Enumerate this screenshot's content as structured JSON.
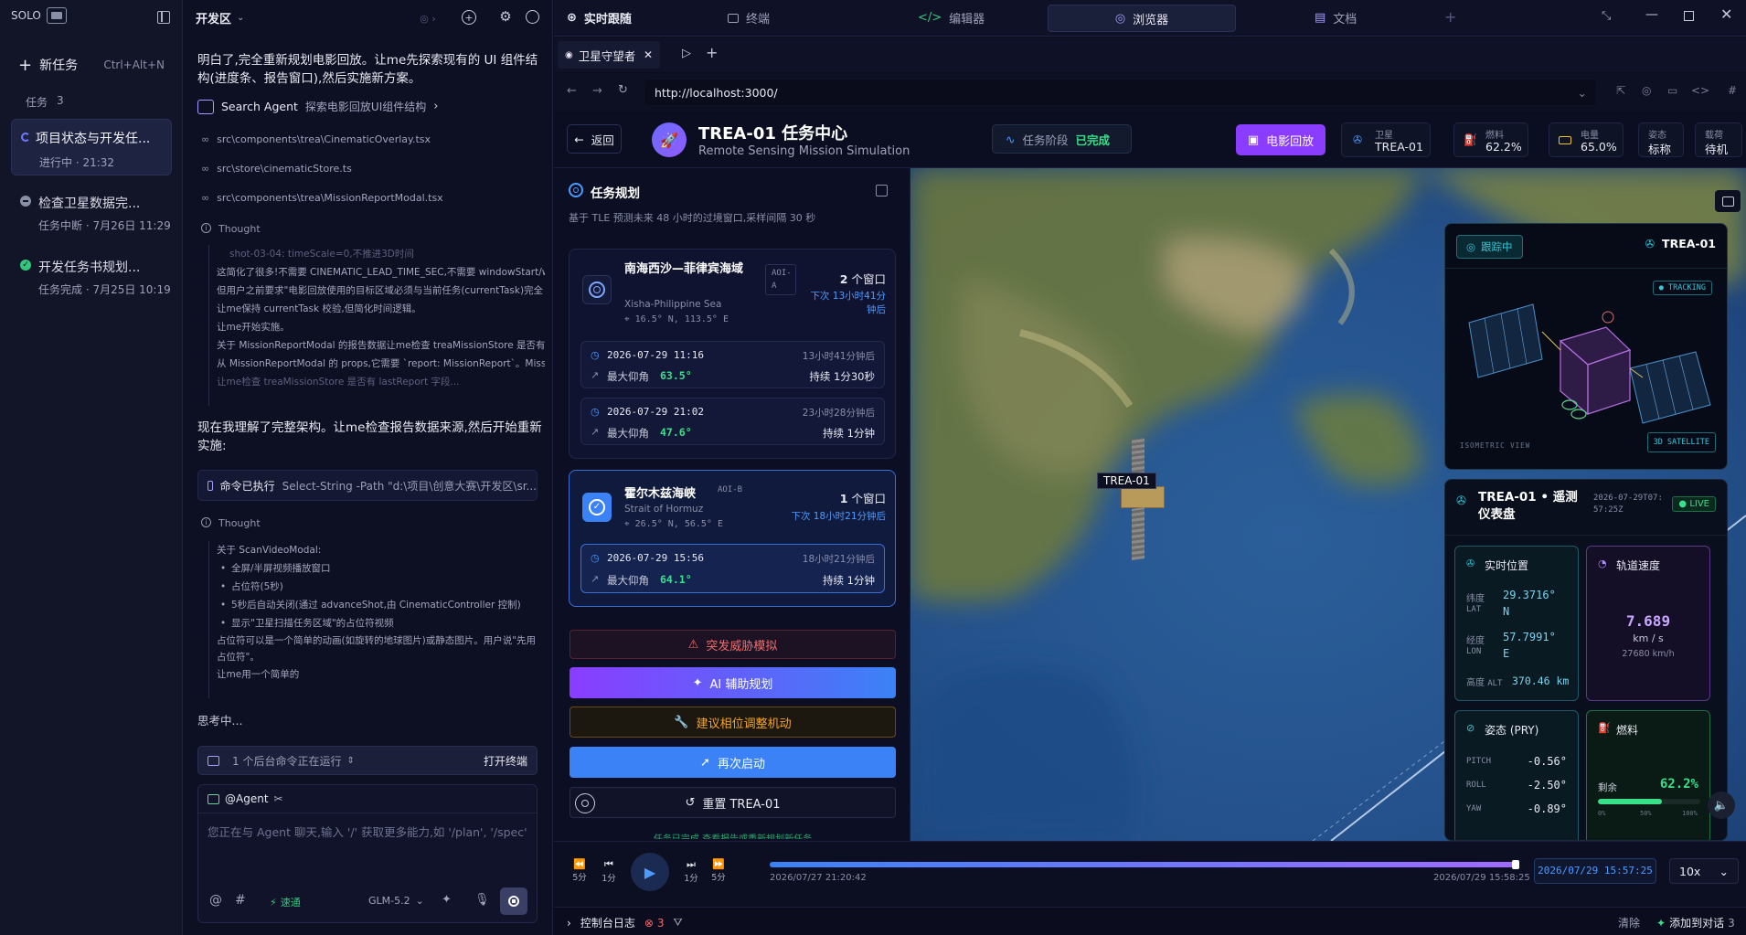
{
  "sidebar": {
    "brand": "SOLO",
    "new_task": "新任务",
    "new_task_shortcut": "Ctrl+Alt+N",
    "tasks_label": "任务",
    "tasks_count": "3",
    "tasks": [
      {
        "title": "项目状态与开发任...",
        "status": "进行中 · 21:32"
      },
      {
        "title": "检查卫星数据完...",
        "status": "任务中断 · 7月26日 11:29"
      },
      {
        "title": "开发任务书规划...",
        "status": "任务完成 · 7月25日 10:19"
      }
    ]
  },
  "chat": {
    "workspace": "开发区",
    "intro": "明白了,完全重新规划电影回放。让me先探索现有的 UI 组件结构(进度条、报告窗口),然后实施新方案。",
    "agent_name": "Search Agent",
    "agent_action": "探索电影回放UI组件结构",
    "files": [
      "src\\components\\trea\\CinematicOverlay.tsx",
      "src\\store\\cinematicStore.ts",
      "src\\components\\trea\\MissionReportModal.tsx"
    ],
    "thought_label": "Thought",
    "thought1_lines": [
      "shot-03-04: timeScale=0,不推进3D时间",
      "这简化了很多!不需要 CINEMATIC_LEAD_TIME_SEC,不需要 windowStart/win",
      "但用户之前要求\"电影回放使用的目标区域必须与当前任务(currentTask)完全",
      "让me保持 currentTask 校验,但简化时间逻辑。",
      "让me开始实施。",
      "关于 MissionReportModal 的报告数据让me检查 treaMissionStore 是否有",
      "从 MissionReportModal 的 props,它需要 `report: MissionReport`。MissionF",
      "让me检查 treaMissionStore 是否有 lastReport 字段..."
    ],
    "summary": "现在我理解了完整架构。让me检查报告数据来源,然后开始重新实施:",
    "command_label": "命令已执行",
    "command_text": "Select-String -Path \"d:\\项目\\创意大赛\\开发区\\sr...",
    "thought2_intro": "关于 ScanVideoModal:",
    "thought2_bullets": [
      "全屏/半屏视频播放窗口",
      "占位符(5秒)",
      "5秒后自动关闭(通过 advanceShot,由 CinematicController 控制)",
      "显示\"卫星扫描任务区域\"的占位符视频"
    ],
    "thought2_tail": [
      "占位符可以是一个简单的动画(如旋转的地球图片)或静态图片。用户说\"先用占位符\"。",
      "让me用一个简单的"
    ],
    "thinking": "思考中...",
    "bg_cmd": "1 个后台命令正在运行",
    "open_terminal": "打开终端",
    "agent_tag": "@Agent",
    "input_placeholder": "您正在与 Agent 聊天,输入 '/' 获取更多能力,如 '/plan', '/spec'",
    "speed_label": "速通",
    "model": "GLM-5.2"
  },
  "tabs": [
    {
      "label": "实时跟随"
    },
    {
      "label": "终端"
    },
    {
      "label": "编辑器"
    },
    {
      "label": "浏览器"
    },
    {
      "label": "文档"
    }
  ],
  "browser": {
    "tab_title": "卫星守望者",
    "url": "http://localhost:3000/"
  },
  "app": {
    "back": "返回",
    "title": "TREA-01 任务中心",
    "subtitle": "Remote Sensing Mission Simulation",
    "phase_label": "任务阶段",
    "phase_value": "已完成",
    "cinema_btn": "电影回放",
    "stats": [
      {
        "label": "卫星",
        "value": "TREA-01"
      },
      {
        "label": "燃料",
        "value": "62.2%"
      },
      {
        "label": "电量",
        "value": "65.0%"
      },
      {
        "label": "姿态",
        "value": "标称"
      },
      {
        "label": "载荷",
        "value": "待机"
      }
    ]
  },
  "planning": {
    "title": "任务规划",
    "subtitle": "基于 TLE 预测未来 48 小时的过境窗口,采样间隔 30 秒",
    "aois": [
      {
        "name": "南海西沙—菲律宾海域",
        "tag": "AOI-A",
        "en": "Xisha-Philippine Sea",
        "coords": "16.5° N, 113.5° E",
        "count_num": "2",
        "count_unit": "个窗口",
        "next": "下次 13小时41分钟后",
        "passes": [
          {
            "time": "2026-07-29 11:16",
            "rel": "13小时41分钟后",
            "elev_label": "最大仰角",
            "elev": "63.5°",
            "dur": "持续 1分30秒"
          },
          {
            "time": "2026-07-29 21:02",
            "rel": "23小时28分钟后",
            "elev_label": "最大仰角",
            "elev": "47.6°",
            "dur": "持续 1分钟"
          }
        ]
      },
      {
        "name": "霍尔木兹海峡",
        "tag": "AOI-B",
        "en": "Strait of Hormuz",
        "coords": "26.5° N, 56.5° E",
        "count_num": "1",
        "count_unit": "个窗口",
        "next": "下次 18小时21分钟后",
        "passes": [
          {
            "time": "2026-07-29 15:56",
            "rel": "18小时21分钟后",
            "elev_label": "最大仰角",
            "elev": "64.1°",
            "dur": "持续 1分钟"
          }
        ]
      }
    ],
    "actions": {
      "threat": "突发威胁模拟",
      "ai": "AI 辅助规划",
      "phase": "建议相位调整机动",
      "restart": "再次启动",
      "reset": "重置 TREA-01"
    },
    "footer_note": "任务已完成,查看报告或重新规划新任务"
  },
  "view3d": {
    "sat_label": "TREA-01",
    "sat_panel": {
      "tracking": "跟踪中",
      "name": "TREA-01",
      "badge": "TRACKING",
      "iso": "ISOMETRIC VIEW",
      "sat3d": "3D SATELLITE"
    },
    "telemetry": {
      "title": "TREA-01 • 遥测仪表盘",
      "date": "2026-07-29T07:57:25Z",
      "live": "LIVE",
      "pos_title": "实时位置",
      "lat_label": "纬度",
      "lat_sub": "LAT",
      "lat": "29.3716°",
      "lat_dir": "N",
      "lon_label": "经度",
      "lon_sub": "LON",
      "lon": "57.7991°",
      "lon_dir": "E",
      "alt_label": "高度",
      "alt_sub": "ALT",
      "alt": "370.46 km",
      "speed_title": "轨道速度",
      "speed": "7.689",
      "speed_unit": "km / s",
      "speed_kmh": "27680 km/h",
      "att_title": "姿态 (PRY)",
      "pitch_label": "PITCH",
      "pitch": "-0.56°",
      "roll_label": "ROLL",
      "roll": "-2.50°",
      "yaw_label": "YAW",
      "yaw": "-0.89°",
      "fuel_title": "燃料",
      "fuel_label": "剩余",
      "fuel": "62.2%",
      "fuel_fraction": 0.622,
      "fuel_ticks": [
        "0%",
        "50%",
        "100%"
      ]
    }
  },
  "timeline": {
    "controls": [
      {
        "label": "5分"
      },
      {
        "label": "1分"
      },
      {
        "label": "1分"
      },
      {
        "label": "5分"
      }
    ],
    "start": "2026/07/27 21:20:42",
    "end": "2026/07/29 15:58:25",
    "current": "2026/07/29 15:57:25",
    "progress": 0.995,
    "speed": "10x"
  },
  "statusbar": {
    "console": "控制台日志",
    "errors": "3",
    "clear": "清除",
    "add_chat": "添加到对话",
    "add_count": "3"
  },
  "colors": {
    "accent": "#7c5cff",
    "green": "#38e08a",
    "cyan": "#36c6d8",
    "blue": "#3b82f6"
  }
}
